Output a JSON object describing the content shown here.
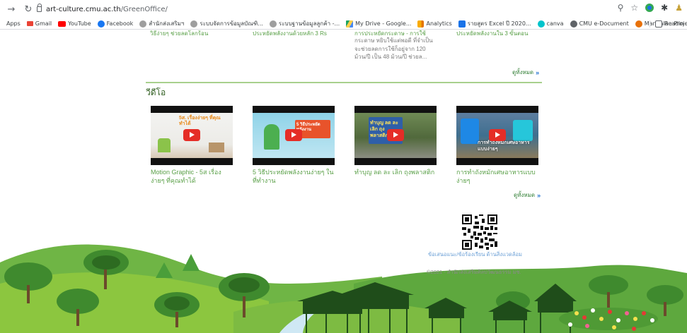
{
  "browser": {
    "url_host": "art-culture.cmu.ac.th",
    "url_path": "/GreenOffice/",
    "bookmarks": [
      {
        "label": "Apps",
        "color": "#5f6368"
      },
      {
        "label": "Gmail",
        "color": "#ea4335"
      },
      {
        "label": "YouTube",
        "color": "#ff0000"
      },
      {
        "label": "Facebook",
        "color": "#1877f2"
      },
      {
        "label": "สำนักส่งเสริมฯ",
        "color": "#8a8a8a"
      },
      {
        "label": "ระบบจัดการข้อมูลบัณฑิ...",
        "color": "#8a8a8a"
      },
      {
        "label": "ระบบฐานข้อมูลลูกค้า -...",
        "color": "#8a8a8a"
      },
      {
        "label": "My Drive - Google...",
        "color": "#fbbc04"
      },
      {
        "label": "Analytics",
        "color": "#f9ab00"
      },
      {
        "label": "รายสูตร Excel ปี 2020...",
        "color": "#1a73e8"
      },
      {
        "label": "canva",
        "color": "#00c4cc"
      },
      {
        "label": "CMU e-Document",
        "color": "#5f6368"
      },
      {
        "label": "Mandala : Project",
        "color": "#e8710a"
      }
    ],
    "reading_list": "Readin"
  },
  "prev_section": {
    "item1": "วิธีง่ายๆ ช่วยลดโลกร้อน",
    "item2": "ประหยัดพลังงานด้วยหลัก 3 Rs",
    "item3_title": "การประหยัดกระดาษ - การใช้",
    "item3_desc": "กระดาษ หยิบใช้แต่พอดี ที่จำเป็น จะช่วยลดการใช้ก็อยู่จาก 120 ม้วน/ปี เป็น 48 ม้วน/ปี ช่วยล...",
    "item4": "ประหยัดพลังงานใน 3 ขั้นตอน",
    "see_all": "ดูทั้งหมด"
  },
  "videos": {
    "title": "วีดีโอ",
    "items": [
      {
        "title": "Motion Graphic - 5ส เรื่องง่ายๆ ที่คุณทำได้",
        "thumb_text": "5ส. เรื่องง่ายๆ ที่คุณทำได้"
      },
      {
        "title": "5 วิธีประหยัดพลังงานง่ายๆ ในที่ทำงาน",
        "thumb_text": "5 วิธีประหยัดพลังงาน"
      },
      {
        "title": "ทำบุญ ลด ละ เลิก ถุงพลาสติก",
        "thumb_text": "ทำบุญ ลด ละ เลิก ถุงพลาสติก"
      },
      {
        "title": "การทำถังหมักเศษอาหารแบบง่ายๆ",
        "thumb_text": "การทำถังหมักเศษอาหารแบบง่ายๆ"
      }
    ],
    "see_all": "ดูทั้งหมด"
  },
  "footer": {
    "qr_caption": "ข้อเสนอแนะ/ข้อร้องเรียน ด้านสิ่งแวดล้อม",
    "copyright": "©2021 - สำนักส่งเสริมศิลปวัฒนธรรม มช."
  }
}
